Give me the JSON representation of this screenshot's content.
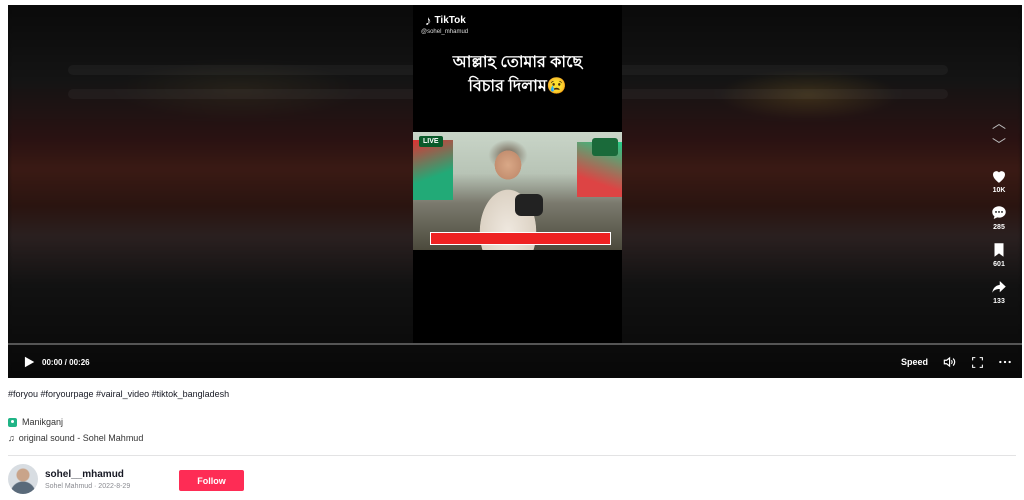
{
  "video": {
    "watermark": "TikTok",
    "handle": "@sohel_mhamud",
    "caption_line1": "আল্লাহ তোমার কাছে",
    "caption_line2": "বিচার দিলাম😢",
    "channel_badge": "LIVE"
  },
  "actions": {
    "likes": "10K",
    "comments": "285",
    "saves": "601",
    "shares": "133"
  },
  "controls": {
    "time": "00:00 / 00:26",
    "speed_label": "Speed",
    "progress": 0
  },
  "meta": {
    "hashtags": "#foryou #foryourpage #vairal_video #tiktok_bangladesh",
    "location": "Manikganj",
    "sound": "original sound - Sohel Mahmud"
  },
  "author": {
    "username": "sohel__mhamud",
    "subline": "Sohel Mahmud · 2022-8-29",
    "follow_label": "Follow"
  },
  "colors": {
    "follow": "#fe2c55",
    "location_icon": "#20b486"
  }
}
